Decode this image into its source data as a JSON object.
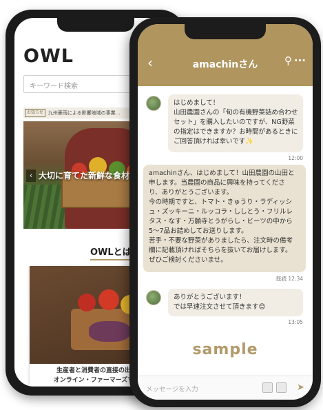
{
  "back_phone": {
    "logo": "OWL",
    "search_placeholder": "キーワード検索",
    "news_badge": "お知らせ",
    "news_text": "九州豪雨による影響地域の事業…",
    "hero_caption": "大切に育てた新鮮な食材を",
    "section_title": "OWLとは",
    "card_line1": "生産者と消費者の直接の出会いの場",
    "card_line2": "オンライン・ファーマーズマーケット"
  },
  "chat": {
    "title": "amachinさん",
    "back_icon": "‹",
    "search_icon": "⚲",
    "more_icon": "···",
    "messages": [
      {
        "from": "customer",
        "lines": [
          "はじめまして！",
          "山田農園さんの「旬の有機野菜詰め合わせ",
          "セット」を購入したいのですが、NG野菜",
          "の指定はできますか？お時間があるときに",
          "ご回答頂ければ幸いです✨"
        ],
        "time": "12:00"
      },
      {
        "from": "seller",
        "lines": [
          "amachinさん、はじめまして！山田農園の山田と",
          "申します。当農園の商品に興味を持ってくださ",
          "り、ありがとうございます。",
          "今の時期ですと、トマト・きゅうり・ラディッシ",
          "ュ・ズッキーニ・ルッコラ・ししとう・フリルレ",
          "タス・なす・万願寺とうがらし・ビーツの中から",
          "5〜7品お詰めしてお送りします。",
          "苦手・不要な野菜がありましたら、注文時の備考",
          "欄に記載頂ければそちらを抜いてお届けします。",
          "ぜひご検討くださいませ。"
        ],
        "time": "既読 12:34"
      },
      {
        "from": "customer",
        "lines": [
          "ありがとうございます！",
          "では早速注文させて頂きます😊"
        ],
        "time": "13:05"
      }
    ],
    "watermark": "sample",
    "input_placeholder": "メッセージを入力",
    "send_icon": "➤"
  },
  "colors": {
    "accent": "#b0955f",
    "bubble_customer": "#f1ede5",
    "bubble_seller": "#e9e2d2",
    "watermark": "#b39a6a"
  }
}
